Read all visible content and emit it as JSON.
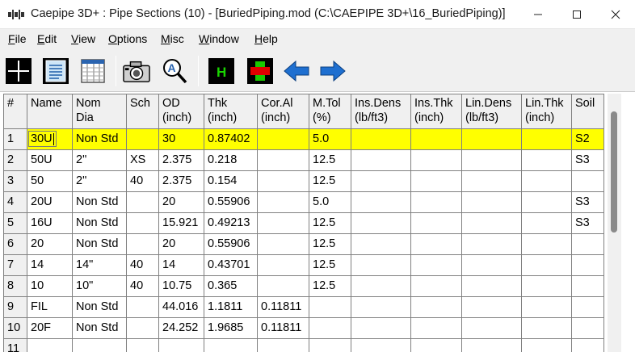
{
  "window": {
    "title": "Caepipe 3D+ : Pipe Sections  (10)  -  [BuriedPiping.mod (C:\\CAEPIPE 3D+\\16_BuriedPiping)]",
    "min_icon": "minimize-icon",
    "max_icon": "maximize-icon",
    "close_icon": "close-icon"
  },
  "menu": [
    {
      "key": "F",
      "rest": "ile"
    },
    {
      "key": "E",
      "rest": "dit"
    },
    {
      "key": "V",
      "rest": "iew"
    },
    {
      "key": "O",
      "rest": "ptions"
    },
    {
      "key": "M",
      "rest": "isc"
    },
    {
      "key": "W",
      "rest": "indow"
    },
    {
      "key": "H",
      "rest": "elp"
    }
  ],
  "toolbar": {
    "buttons": [
      "crosshair-icon",
      "notepad-icon",
      "table-icon",
      "camera-icon",
      "zoom-text-icon",
      "h-icon",
      "plus-cross-icon",
      "arrow-left-icon",
      "arrow-right-icon"
    ],
    "h_label": "H"
  },
  "grid": {
    "headers": [
      [
        "#",
        ""
      ],
      [
        "Name",
        ""
      ],
      [
        "Nom",
        "Dia"
      ],
      [
        "Sch",
        ""
      ],
      [
        "OD",
        "(inch)"
      ],
      [
        "Thk",
        "(inch)"
      ],
      [
        "Cor.Al",
        "(inch)"
      ],
      [
        "M.Tol",
        "(%)"
      ],
      [
        "Ins.Dens",
        "(lb/ft3)"
      ],
      [
        "Ins.Thk",
        "(inch)"
      ],
      [
        "Lin.Dens",
        "(lb/ft3)"
      ],
      [
        "Lin.Thk",
        "(inch)"
      ],
      [
        "Soil",
        ""
      ]
    ],
    "rows": [
      [
        "1",
        "30U",
        "Non Std",
        "",
        "30",
        "0.87402",
        "",
        "5.0",
        "",
        "",
        "",
        "",
        "S2"
      ],
      [
        "2",
        "50U",
        "2\"",
        "XS",
        "2.375",
        "0.218",
        "",
        "12.5",
        "",
        "",
        "",
        "",
        "S3"
      ],
      [
        "3",
        "50",
        "2\"",
        "40",
        "2.375",
        "0.154",
        "",
        "12.5",
        "",
        "",
        "",
        "",
        ""
      ],
      [
        "4",
        "20U",
        "Non Std",
        "",
        "20",
        "0.55906",
        "",
        "5.0",
        "",
        "",
        "",
        "",
        "S3"
      ],
      [
        "5",
        "16U",
        "Non Std",
        "",
        "15.921",
        "0.49213",
        "",
        "12.5",
        "",
        "",
        "",
        "",
        "S3"
      ],
      [
        "6",
        "20",
        "Non Std",
        "",
        "20",
        "0.55906",
        "",
        "12.5",
        "",
        "",
        "",
        "",
        ""
      ],
      [
        "7",
        "14",
        "14\"",
        "40",
        "14",
        "0.43701",
        "",
        "12.5",
        "",
        "",
        "",
        "",
        ""
      ],
      [
        "8",
        "10",
        "10\"",
        "40",
        "10.75",
        "0.365",
        "",
        "12.5",
        "",
        "",
        "",
        "",
        ""
      ],
      [
        "9",
        "FIL",
        "Non Std",
        "",
        "44.016",
        "1.1811",
        "0.11811",
        "",
        "",
        "",
        "",
        "",
        ""
      ],
      [
        "10",
        "20F",
        "Non Std",
        "",
        "24.252",
        "1.9685",
        "0.11811",
        "",
        "",
        "",
        "",
        "",
        ""
      ],
      [
        "11",
        "",
        "",
        "",
        "",
        "",
        "",
        "",
        "",
        "",
        "",
        "",
        ""
      ]
    ],
    "selected_row_highlight": "#ffff00"
  }
}
